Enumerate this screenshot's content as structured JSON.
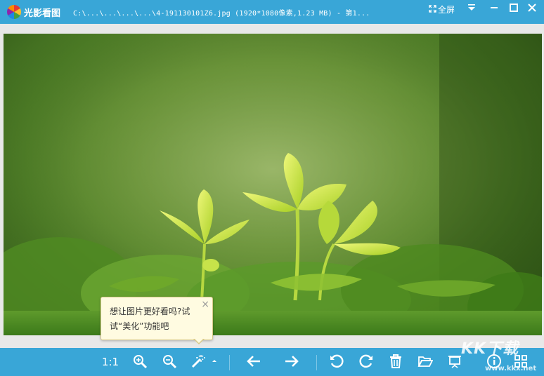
{
  "titlebar": {
    "app_name": "光影看图",
    "file_info": "C:\\...\\...\\...\\...\\4-191130101Z6.jpg (1920*1080像素,1.23 MB) - 第1...",
    "fullscreen_label": "全屏",
    "fullscreen_icon": "fullscreen-icon",
    "menu_icon": "dropdown-menu-icon",
    "minimize_icon": "minimize-icon",
    "maximize_icon": "maximize-icon",
    "close_icon": "close-icon"
  },
  "tooltip": {
    "text": "想让图片更好看吗?试试“美化”功能吧",
    "close": "×"
  },
  "toolbar": {
    "ratio_label": "1:1",
    "buttons": [
      "zoom-in-icon",
      "zoom-out-icon",
      "beautify-wand-icon",
      "wand-expand-icon",
      "previous-arrow-icon",
      "next-arrow-icon",
      "rotate-left-icon",
      "rotate-right-icon",
      "delete-icon",
      "open-folder-icon",
      "slideshow-icon",
      "info-icon",
      "grid-view-icon"
    ]
  },
  "watermark": {
    "brand": "KK下载",
    "domain": "www.kkx.net"
  },
  "colors": {
    "titlebar": "#39a6d7",
    "toolbar": "#39a6d7",
    "tooltip_bg": "#fffbe1"
  }
}
